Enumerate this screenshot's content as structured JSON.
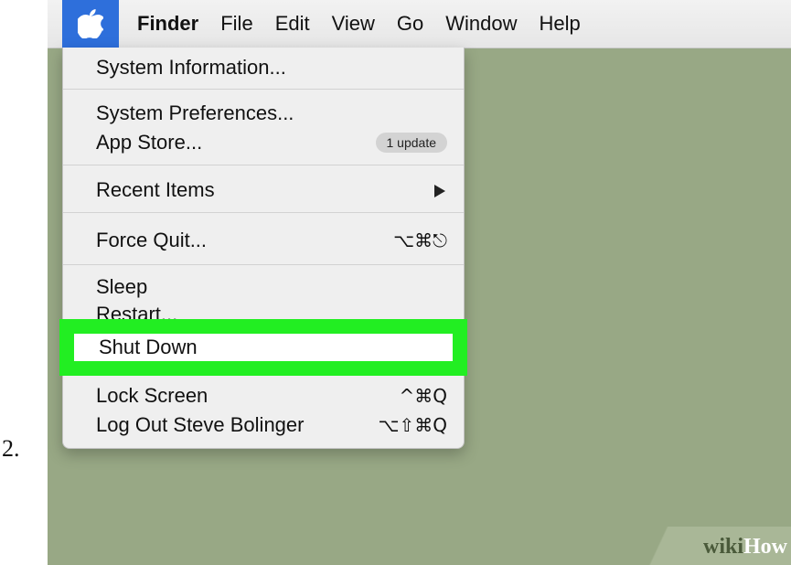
{
  "step": {
    "number": "2."
  },
  "menubar": {
    "apple_icon": "apple-icon",
    "app_name": "Finder",
    "items": [
      "File",
      "Edit",
      "View",
      "Go",
      "Window",
      "Help"
    ]
  },
  "apple_menu": {
    "system_information": "System Information...",
    "system_preferences": "System Preferences...",
    "app_store": "App Store...",
    "app_store_badge": "1 update",
    "recent_items": "Recent Items",
    "force_quit": "Force Quit...",
    "force_quit_shortcut": "⌥⌘⎋",
    "sleep": "Sleep",
    "restart": "Restart...",
    "shut_down": "Shut Down",
    "lock_screen": "Lock Screen",
    "lock_screen_shortcut": "^⌘Q",
    "log_out": "Log Out Steve Bolinger",
    "log_out_shortcut": "⌥⇧⌘Q"
  },
  "highlight_color": "#22ee22",
  "watermark": {
    "wiki": "wiki",
    "how": "How"
  }
}
